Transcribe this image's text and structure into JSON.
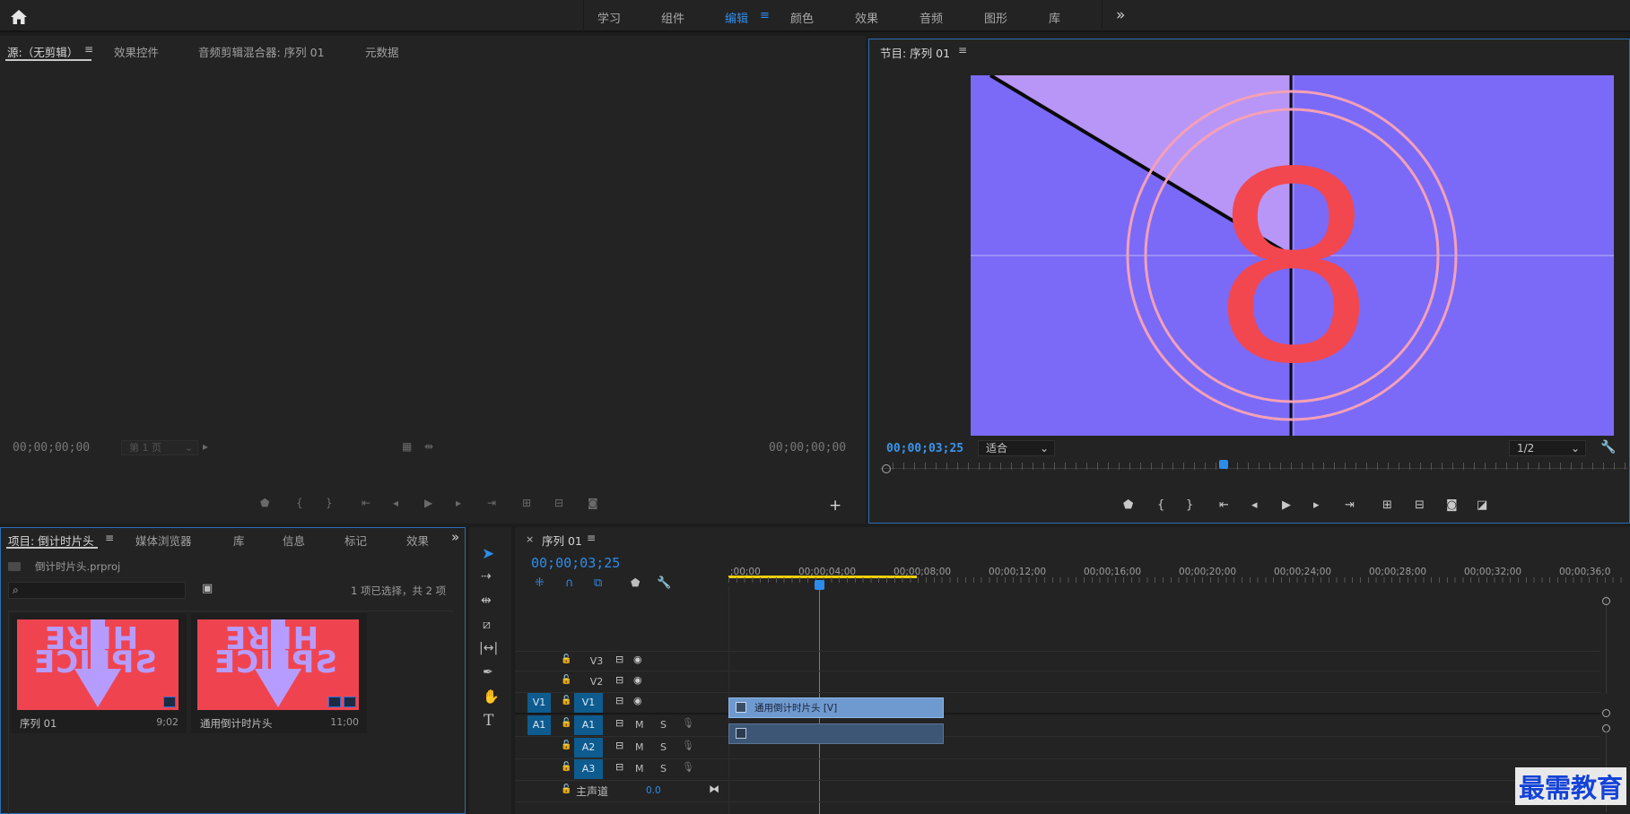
{
  "workspaces": {
    "items": [
      "学习",
      "组件",
      "编辑",
      "颜色",
      "效果",
      "音频",
      "图形",
      "库"
    ],
    "active_index": 2,
    "more": "»"
  },
  "source_panel": {
    "tabs": [
      "源:（无剪辑）",
      "效果控件",
      "音频剪辑混合器: 序列 01",
      "元数据"
    ],
    "timecode_in": "00;00;00;00",
    "page_select": "第 1 页",
    "timecode_out": "00;00;00;00"
  },
  "program_panel": {
    "title": "节目: 序列 01",
    "timecode": "00;00;03;25",
    "fit_select": "适合",
    "resolution_select": "1/2",
    "preview_number": "8",
    "playhead_fraction": 0.45,
    "colors": {
      "bg": "#7b6af8",
      "wedge": "#b796f7",
      "digit": "#f2474f",
      "ring": "#f5a0b6"
    }
  },
  "project_panel": {
    "tabs": [
      "项目: 倒计时片头",
      "媒体浏览器",
      "库",
      "信息",
      "标记",
      "效果"
    ],
    "project_file": "倒计时片头.prproj",
    "selection_status": "1 项已选择，共 2 项",
    "items": [
      {
        "name": "序列 01",
        "duration": "9;02"
      },
      {
        "name": "通用倒计时片头",
        "duration": "11;00"
      }
    ],
    "thumb_text_top": "HERE",
    "thumb_text_bottom": "SPLICE"
  },
  "timeline": {
    "tab": "序列 01",
    "timecode": "00;00;03;25",
    "ruler": [
      ";00;00",
      "00;00;04;00",
      "00;00;08;00",
      "00;00;12;00",
      "00;00;16;00",
      "00;00;20;00",
      "00;00;24;00",
      "00;00;28;00",
      "00;00;32;00",
      "00;00;36;0"
    ],
    "video_tracks": [
      "V3",
      "V2",
      "V1"
    ],
    "audio_tracks": [
      "A1",
      "A2",
      "A3"
    ],
    "source_patch_video": "V1",
    "source_patch_audio": "A1",
    "mute_label": "M",
    "solo_label": "S",
    "master_label": "主声道",
    "master_value": "0.0",
    "video_clip": "通用倒计时片头 [V]"
  },
  "watermark": "最需教育"
}
